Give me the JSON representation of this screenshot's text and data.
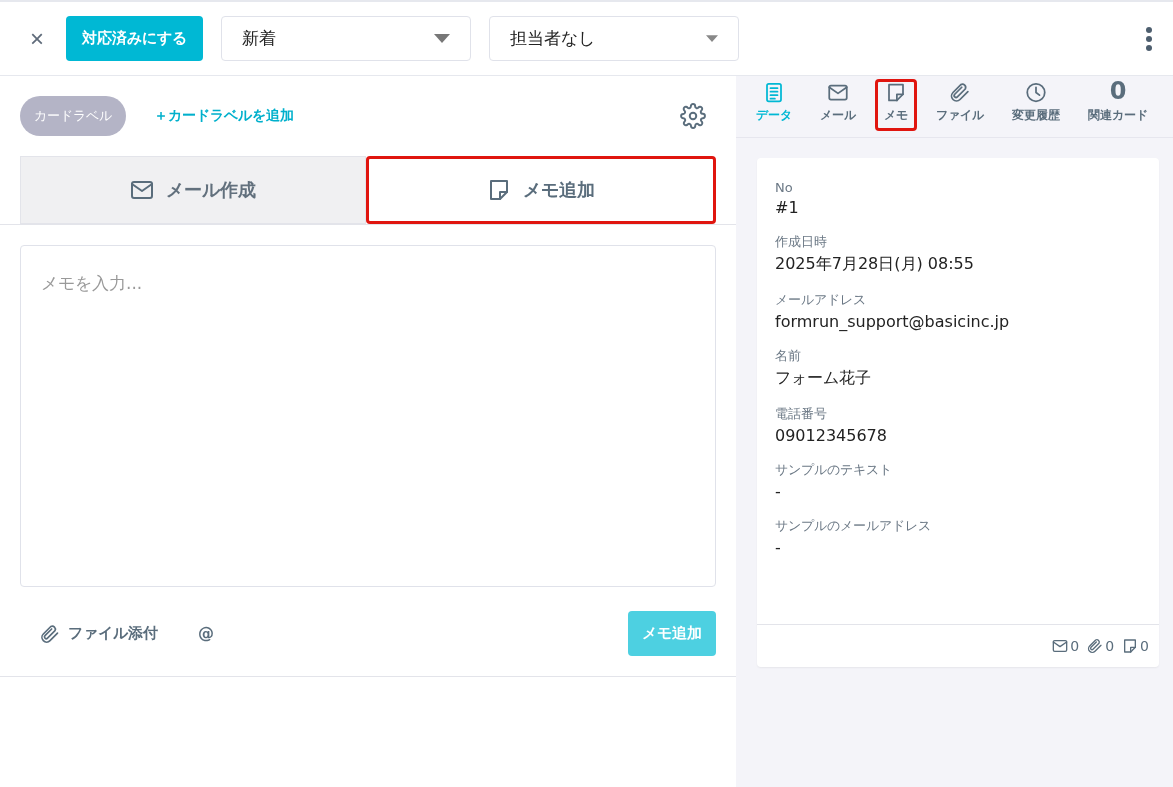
{
  "toolbar": {
    "close": "×",
    "resolve_button": "対応済みにする",
    "status_select": {
      "value": "新着"
    },
    "assignee_select": {
      "value": "担当者なし"
    }
  },
  "labels": {
    "chip": "カードラベル",
    "add_link": "＋カードラベルを追加"
  },
  "compose_tabs": [
    {
      "kind": "mail",
      "label": "メール作成",
      "selected": false,
      "highlighted": false
    },
    {
      "kind": "memo",
      "label": "メモ追加",
      "selected": true,
      "highlighted": true
    }
  ],
  "memo": {
    "placeholder": "メモを入力...",
    "attach": "ファイル添付",
    "mention": "@",
    "submit": "メモ追加",
    "submit_disabled": true
  },
  "side_tabs": [
    {
      "kind": "data",
      "label": "データ",
      "selected": true,
      "highlighted": false
    },
    {
      "kind": "mail",
      "label": "メール",
      "selected": false,
      "highlighted": false
    },
    {
      "kind": "memo",
      "label": "メモ",
      "selected": false,
      "highlighted": true
    },
    {
      "kind": "file",
      "label": "ファイル",
      "selected": false,
      "highlighted": false
    },
    {
      "kind": "history",
      "label": "変更履歴",
      "selected": false,
      "highlighted": false
    },
    {
      "kind": "count",
      "count": "0",
      "label": "関連カード",
      "selected": false,
      "highlighted": false
    }
  ],
  "record": {
    "fields": [
      {
        "label": "No",
        "value": "#1"
      },
      {
        "label": "作成日時",
        "value": "2025年7月28日(月) 08:55"
      },
      {
        "label": "メールアドレス",
        "value": "formrun_support@basicinc.jp"
      },
      {
        "label": "名前",
        "value": "フォーム花子"
      },
      {
        "label": "電話番号",
        "value": "09012345678"
      },
      {
        "label": "サンプルのテキスト",
        "value": "-"
      },
      {
        "label": "サンプルのメールアドレス",
        "value": "-"
      }
    ],
    "counts": [
      {
        "kind": "mail",
        "value": "0"
      },
      {
        "kind": "file",
        "value": "0"
      },
      {
        "kind": "memo",
        "value": "0"
      }
    ]
  }
}
